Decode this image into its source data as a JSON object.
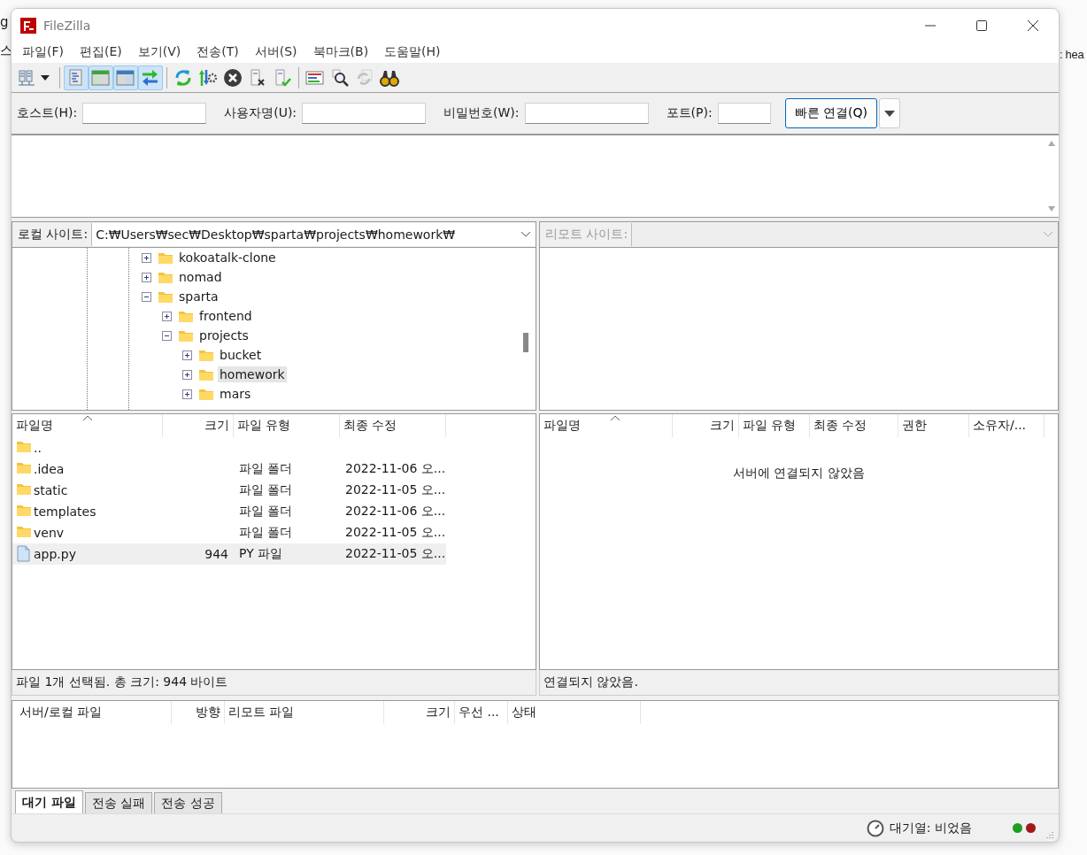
{
  "background": {
    "left": [
      "g",
      "스"
    ],
    "right": [
      ": hea"
    ]
  },
  "window": {
    "title": "FileZilla"
  },
  "menu": [
    "파일(F)",
    "편집(E)",
    "보기(V)",
    "전송(T)",
    "서버(S)",
    "북마크(B)",
    "도움말(H)"
  ],
  "toolbar": [
    {
      "selected": false,
      "disabled": false
    },
    {
      "selected": true,
      "disabled": false
    },
    {
      "selected": true,
      "disabled": false
    },
    {
      "selected": true,
      "disabled": false
    },
    {
      "selected": true,
      "disabled": false
    },
    {
      "selected": false,
      "disabled": false
    },
    {
      "selected": false,
      "disabled": false
    },
    {
      "selected": false,
      "disabled": false
    },
    {
      "selected": false,
      "disabled": false
    },
    {
      "selected": false,
      "disabled": false
    },
    {
      "selected": false,
      "disabled": false
    },
    {
      "selected": false,
      "disabled": false
    },
    {
      "selected": false,
      "disabled": true
    },
    {
      "selected": false,
      "disabled": false
    }
  ],
  "quickconnect": {
    "fields": [
      {
        "label": "호스트(H):",
        "kind": "wide"
      },
      {
        "label": "사용자명(U):",
        "kind": "wide"
      },
      {
        "label": "비밀번호(W):",
        "kind": "wide"
      },
      {
        "label": "포트(P):",
        "kind": "narrow"
      }
    ],
    "button": "빠른 연결(Q)"
  },
  "local": {
    "site_label": "로컬 사이트:",
    "path": "C:₩Users₩sec₩Desktop₩sparta₩projects₩homework₩",
    "tree": [
      {
        "name": "kokoatalk-clone",
        "expanded": false,
        "selected": false
      },
      {
        "name": "nomad",
        "expanded": false,
        "selected": false
      },
      {
        "name": "sparta",
        "expanded": true,
        "selected": false,
        "children": [
          {
            "name": "frontend",
            "expanded": false,
            "selected": false
          },
          {
            "name": "projects",
            "expanded": true,
            "selected": false,
            "children": [
              {
                "name": "bucket",
                "expanded": false,
                "selected": false
              },
              {
                "name": "homework",
                "expanded": false,
                "selected": true
              },
              {
                "name": "mars",
                "expanded": false,
                "selected": false
              }
            ]
          }
        ]
      }
    ],
    "columns": [
      "파일명",
      "크기",
      "파일 유형",
      "최종 수정"
    ],
    "rows": [
      {
        "kind": "folder",
        "name": "..",
        "size": "",
        "type": "",
        "modified": "",
        "selected": false
      },
      {
        "kind": "folder",
        "name": ".idea",
        "type": "파일 폴더",
        "modified": "2022-11-06 오...",
        "selected": false
      },
      {
        "kind": "folder",
        "name": "static",
        "type": "파일 폴더",
        "modified": "2022-11-05 오...",
        "selected": false
      },
      {
        "kind": "folder",
        "name": "templates",
        "type": "파일 폴더",
        "modified": "2022-11-06 오...",
        "selected": false
      },
      {
        "kind": "folder",
        "name": "venv",
        "type": "파일 폴더",
        "modified": "2022-11-05 오...",
        "selected": false
      },
      {
        "kind": "file",
        "name": "app.py",
        "size": "944",
        "type": "PY 파일",
        "modified": "2022-11-05 오...",
        "selected": true
      }
    ],
    "status": "파일 1개 선택됨. 총 크기: 944 바이트"
  },
  "remote": {
    "site_label": "리모트 사이트:",
    "columns": [
      "파일명",
      "크기",
      "파일 유형",
      "최종 수정",
      "권한",
      "소유자/..."
    ],
    "message": "서버에 연결되지 않았음",
    "status": "연결되지 않았음."
  },
  "queue": {
    "columns": [
      "서버/로컬 파일",
      "방향",
      "리모트 파일",
      "크기",
      "우선 ...",
      "상태"
    ]
  },
  "tabs": [
    {
      "label": "대기 파일",
      "selected": true
    },
    {
      "label": "전송 실패",
      "selected": false
    },
    {
      "label": "전송 성공",
      "selected": false
    }
  ],
  "status_bar": {
    "queue": "대기열: 비었음",
    "lights": [
      {
        "color": "#1e9e1e"
      },
      {
        "color": "#a01818"
      }
    ]
  }
}
